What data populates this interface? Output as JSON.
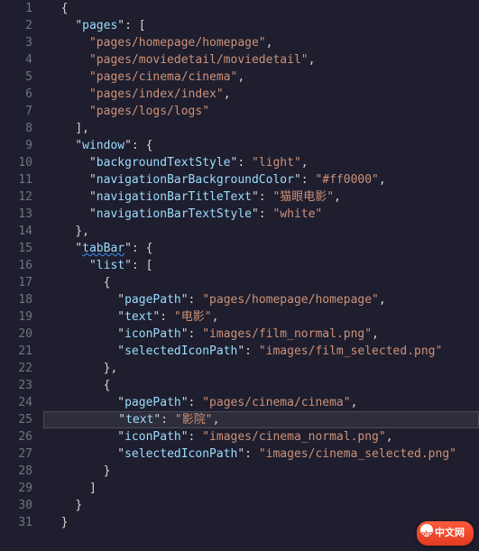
{
  "line_numbers": [
    "1",
    "2",
    "3",
    "4",
    "5",
    "6",
    "7",
    "8",
    "9",
    "10",
    "11",
    "12",
    "13",
    "14",
    "15",
    "16",
    "17",
    "18",
    "19",
    "20",
    "21",
    "22",
    "23",
    "24",
    "25",
    "26",
    "27",
    "28",
    "29",
    "30",
    "31"
  ],
  "code": {
    "l1": {
      "i": "  ",
      "t": [
        {
          "c": "p",
          "v": "{"
        }
      ]
    },
    "l2": {
      "i": "    ",
      "t": [
        {
          "c": "p",
          "v": "\""
        },
        {
          "c": "k",
          "v": "pages"
        },
        {
          "c": "p",
          "v": "\": ["
        }
      ]
    },
    "l3": {
      "i": "      ",
      "t": [
        {
          "c": "s",
          "v": "\"pages/homepage/homepage\""
        },
        {
          "c": "p",
          "v": ","
        }
      ]
    },
    "l4": {
      "i": "      ",
      "t": [
        {
          "c": "s",
          "v": "\"pages/moviedetail/moviedetail\""
        },
        {
          "c": "p",
          "v": ","
        }
      ]
    },
    "l5": {
      "i": "      ",
      "t": [
        {
          "c": "s",
          "v": "\"pages/cinema/cinema\""
        },
        {
          "c": "p",
          "v": ","
        }
      ]
    },
    "l6": {
      "i": "      ",
      "t": [
        {
          "c": "s",
          "v": "\"pages/index/index\""
        },
        {
          "c": "p",
          "v": ","
        }
      ]
    },
    "l7": {
      "i": "      ",
      "t": [
        {
          "c": "s",
          "v": "\"pages/logs/logs\""
        }
      ]
    },
    "l8": {
      "i": "    ",
      "t": [
        {
          "c": "p",
          "v": "],"
        }
      ]
    },
    "l9": {
      "i": "    ",
      "t": [
        {
          "c": "p",
          "v": "\""
        },
        {
          "c": "k",
          "v": "window"
        },
        {
          "c": "p",
          "v": "\": {"
        }
      ]
    },
    "l10": {
      "i": "      ",
      "t": [
        {
          "c": "p",
          "v": "\""
        },
        {
          "c": "k",
          "v": "backgroundTextStyle"
        },
        {
          "c": "p",
          "v": "\": "
        },
        {
          "c": "s",
          "v": "\"light\""
        },
        {
          "c": "p",
          "v": ","
        }
      ]
    },
    "l11": {
      "i": "      ",
      "t": [
        {
          "c": "p",
          "v": "\""
        },
        {
          "c": "k",
          "v": "navigationBarBackgroundColor"
        },
        {
          "c": "p",
          "v": "\": "
        },
        {
          "c": "s",
          "v": "\"#ff0000\""
        },
        {
          "c": "p",
          "v": ","
        }
      ]
    },
    "l12": {
      "i": "      ",
      "t": [
        {
          "c": "p",
          "v": "\""
        },
        {
          "c": "k",
          "v": "navigationBarTitleText"
        },
        {
          "c": "p",
          "v": "\": "
        },
        {
          "c": "s",
          "v": "\"猫眼电影\""
        },
        {
          "c": "p",
          "v": ","
        }
      ]
    },
    "l13": {
      "i": "      ",
      "t": [
        {
          "c": "p",
          "v": "\""
        },
        {
          "c": "k",
          "v": "navigationBarTextStyle"
        },
        {
          "c": "p",
          "v": "\": "
        },
        {
          "c": "s",
          "v": "\"white\""
        }
      ]
    },
    "l14": {
      "i": "    ",
      "t": [
        {
          "c": "p",
          "v": "},"
        }
      ]
    },
    "l15": {
      "i": "    ",
      "t": [
        {
          "c": "p",
          "v": "\""
        },
        {
          "c": "k",
          "v": "tabBar",
          "sq": true
        },
        {
          "c": "p",
          "v": "\": {"
        }
      ]
    },
    "l16": {
      "i": "      ",
      "t": [
        {
          "c": "p",
          "v": "\""
        },
        {
          "c": "k",
          "v": "list"
        },
        {
          "c": "p",
          "v": "\": ["
        }
      ]
    },
    "l17": {
      "i": "        ",
      "t": [
        {
          "c": "p",
          "v": "{"
        }
      ]
    },
    "l18": {
      "i": "          ",
      "t": [
        {
          "c": "p",
          "v": "\""
        },
        {
          "c": "k",
          "v": "pagePath"
        },
        {
          "c": "p",
          "v": "\": "
        },
        {
          "c": "s",
          "v": "\"pages/homepage/homepage\""
        },
        {
          "c": "p",
          "v": ","
        }
      ]
    },
    "l19": {
      "i": "          ",
      "t": [
        {
          "c": "p",
          "v": "\""
        },
        {
          "c": "k",
          "v": "text"
        },
        {
          "c": "p",
          "v": "\": "
        },
        {
          "c": "s",
          "v": "\"电影\""
        },
        {
          "c": "p",
          "v": ","
        }
      ]
    },
    "l20": {
      "i": "          ",
      "t": [
        {
          "c": "p",
          "v": "\""
        },
        {
          "c": "k",
          "v": "iconPath"
        },
        {
          "c": "p",
          "v": "\": "
        },
        {
          "c": "s",
          "v": "\"images/film_normal.png\""
        },
        {
          "c": "p",
          "v": ","
        }
      ]
    },
    "l21": {
      "i": "          ",
      "t": [
        {
          "c": "p",
          "v": "\""
        },
        {
          "c": "k",
          "v": "selectedIconPath"
        },
        {
          "c": "p",
          "v": "\": "
        },
        {
          "c": "s",
          "v": "\"images/film_selected.png\""
        }
      ]
    },
    "l22": {
      "i": "        ",
      "t": [
        {
          "c": "p",
          "v": "},"
        }
      ]
    },
    "l23": {
      "i": "        ",
      "t": [
        {
          "c": "p",
          "v": "{"
        }
      ]
    },
    "l24": {
      "i": "          ",
      "t": [
        {
          "c": "p",
          "v": "\""
        },
        {
          "c": "k",
          "v": "pagePath"
        },
        {
          "c": "p",
          "v": "\": "
        },
        {
          "c": "s",
          "v": "\"pages/cinema/cinema\""
        },
        {
          "c": "p",
          "v": ","
        }
      ]
    },
    "l25": {
      "i": "          ",
      "t": [
        {
          "c": "p",
          "v": "\""
        },
        {
          "c": "k",
          "v": "text"
        },
        {
          "c": "p",
          "v": "\": "
        },
        {
          "c": "s",
          "v": "\"影院\""
        },
        {
          "c": "p",
          "v": ","
        }
      ],
      "hl": true
    },
    "l26": {
      "i": "          ",
      "t": [
        {
          "c": "p",
          "v": "\""
        },
        {
          "c": "k",
          "v": "iconPath"
        },
        {
          "c": "p",
          "v": "\": "
        },
        {
          "c": "s",
          "v": "\"images/cinema_normal.png\""
        },
        {
          "c": "p",
          "v": ","
        }
      ]
    },
    "l27": {
      "i": "          ",
      "t": [
        {
          "c": "p",
          "v": "\""
        },
        {
          "c": "k",
          "v": "selectedIconPath"
        },
        {
          "c": "p",
          "v": "\": "
        },
        {
          "c": "s",
          "v": "\"images/cinema_selected.png\""
        }
      ]
    },
    "l28": {
      "i": "        ",
      "t": [
        {
          "c": "p",
          "v": "}"
        }
      ]
    },
    "l29": {
      "i": "      ",
      "t": [
        {
          "c": "p",
          "v": "]"
        }
      ]
    },
    "l30": {
      "i": "    ",
      "t": [
        {
          "c": "p",
          "v": "}"
        }
      ]
    },
    "l31": {
      "i": "  ",
      "t": [
        {
          "c": "p",
          "v": "}"
        }
      ]
    }
  },
  "badge": "中文网"
}
